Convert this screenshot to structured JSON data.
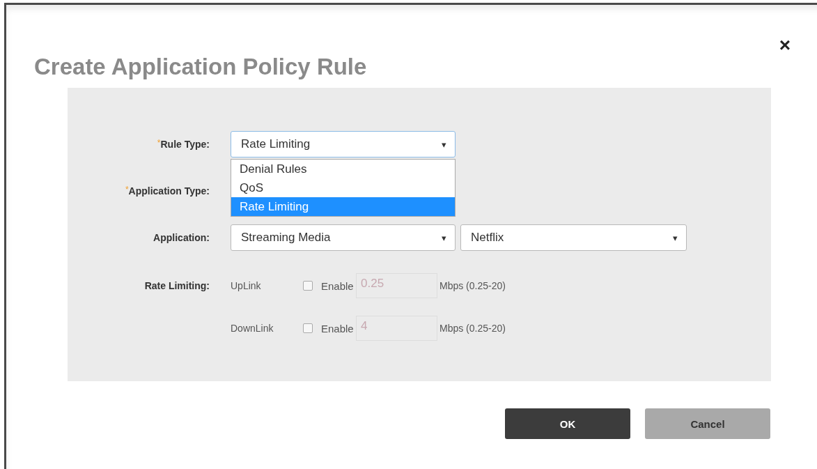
{
  "dialog": {
    "title": "Create Application Policy Rule",
    "close": "×"
  },
  "rule_type": {
    "required_mark": "*",
    "label": "Rule Type:",
    "value": "Rate Limiting",
    "caret": "▾",
    "open": true,
    "options": [
      {
        "label": "Denial Rules",
        "selected": false
      },
      {
        "label": "QoS",
        "selected": false
      },
      {
        "label": "Rate Limiting",
        "selected": true
      }
    ]
  },
  "application_type": {
    "required_mark": "*",
    "label": "Application Type:"
  },
  "application": {
    "label": "Application:",
    "category": "Streaming Media",
    "app": "Netflix",
    "caret": "▾"
  },
  "rate_limiting": {
    "label": "Rate Limiting:",
    "rows": [
      {
        "direction": "UpLink",
        "enable_label": "Enable",
        "checked": false,
        "value": "0.25",
        "unit": "Mbps (0.25-20)"
      },
      {
        "direction": "DownLink",
        "enable_label": "Enable",
        "checked": false,
        "value": "4",
        "unit": "Mbps (0.25-20)"
      }
    ]
  },
  "buttons": [
    {
      "label": "OK",
      "kind": "primary"
    },
    {
      "label": "Cancel",
      "kind": "secondary"
    }
  ]
}
